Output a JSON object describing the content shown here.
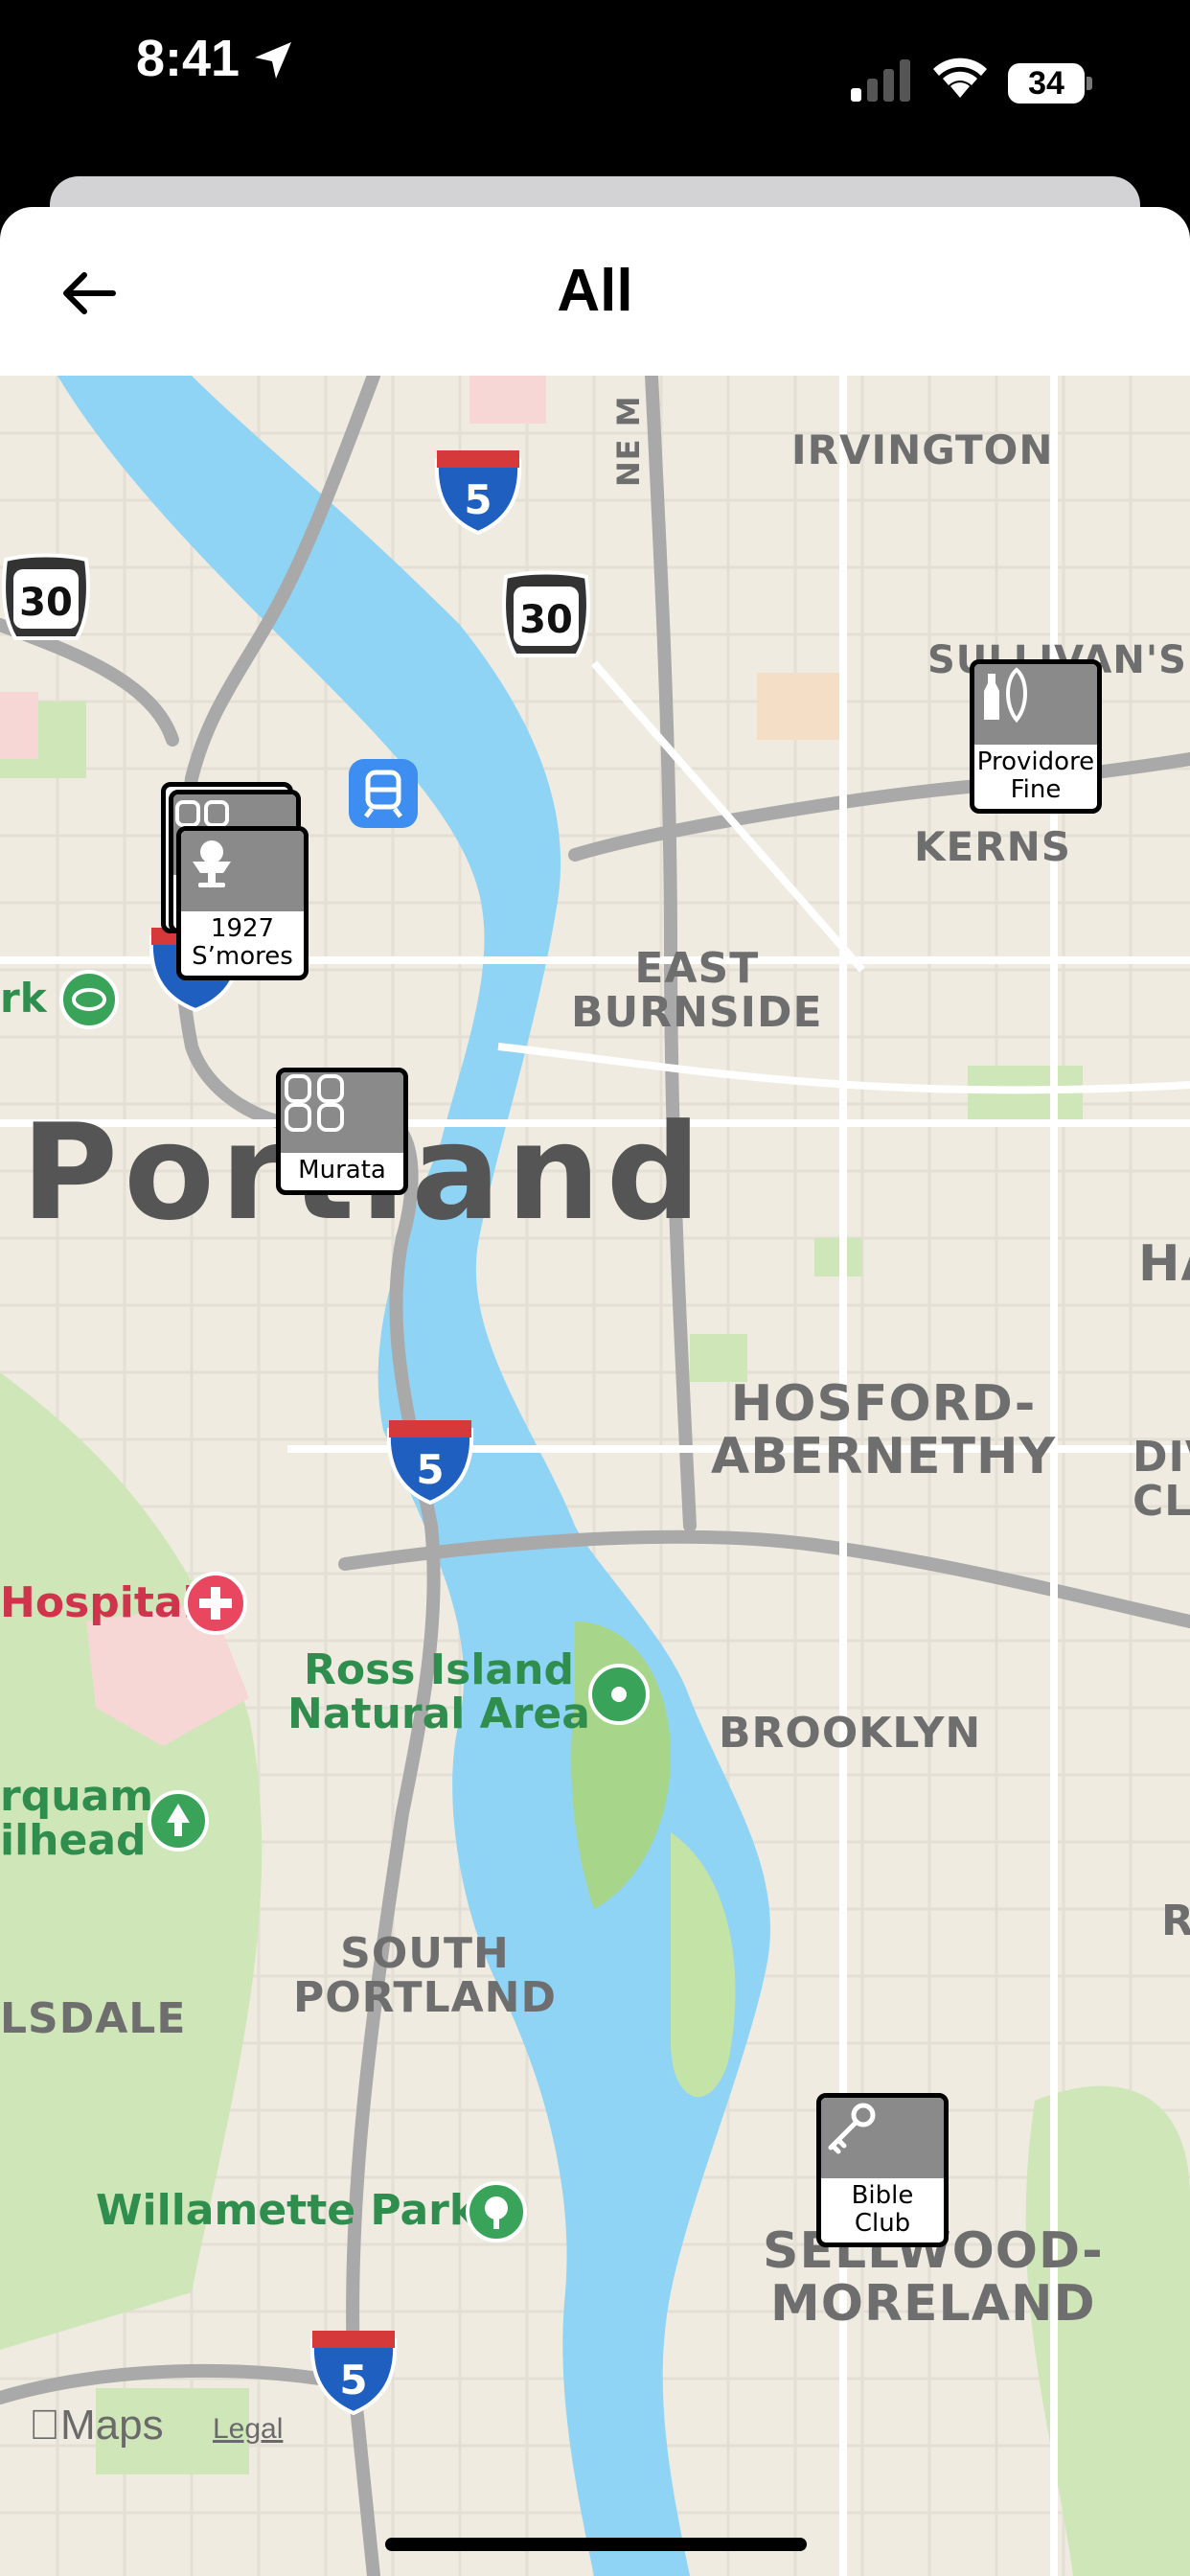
{
  "status_bar": {
    "time": "8:41",
    "battery": "34"
  },
  "header": {
    "title": "All"
  },
  "map": {
    "labels": {
      "irvington": "IRVINGTON",
      "sullivans": "SULLIVAN'S",
      "kerns": "KERNS",
      "east_burnside": "EAST\nBURNSIDE",
      "portland": "Portland",
      "hosford": "HOSFORD-\nABERNETHY",
      "brooklyn": "BROOKLYN",
      "south_portland": "SOUTH\nPORTLAND",
      "sellwood": "SELLWOOD-\nMORELAND",
      "lsdale": "LSDALE",
      "ne_m": "NE M",
      "ha": "HA",
      "div_cl": "DIV\nCL",
      "r": "R"
    },
    "places": {
      "hospital": "Hospital",
      "ross_island": "Ross Island\nNatural Area",
      "marquam": "rquam\nilhead",
      "willamette": "Willamette Park",
      "park_left": "rk"
    },
    "shields": {
      "i5": "5",
      "us30": "30"
    },
    "pins": [
      {
        "label": "1927\nS’mores",
        "icon": "ice-cream-icon"
      },
      {
        "label": "Murata",
        "icon": "sushi-icon"
      },
      {
        "label": "Providore\nFine",
        "icon": "grocery-icon"
      },
      {
        "label": "Bible\nClub",
        "icon": "key-icon"
      }
    ],
    "attribution": {
      "maps": "Maps",
      "legal": "Legal"
    }
  }
}
